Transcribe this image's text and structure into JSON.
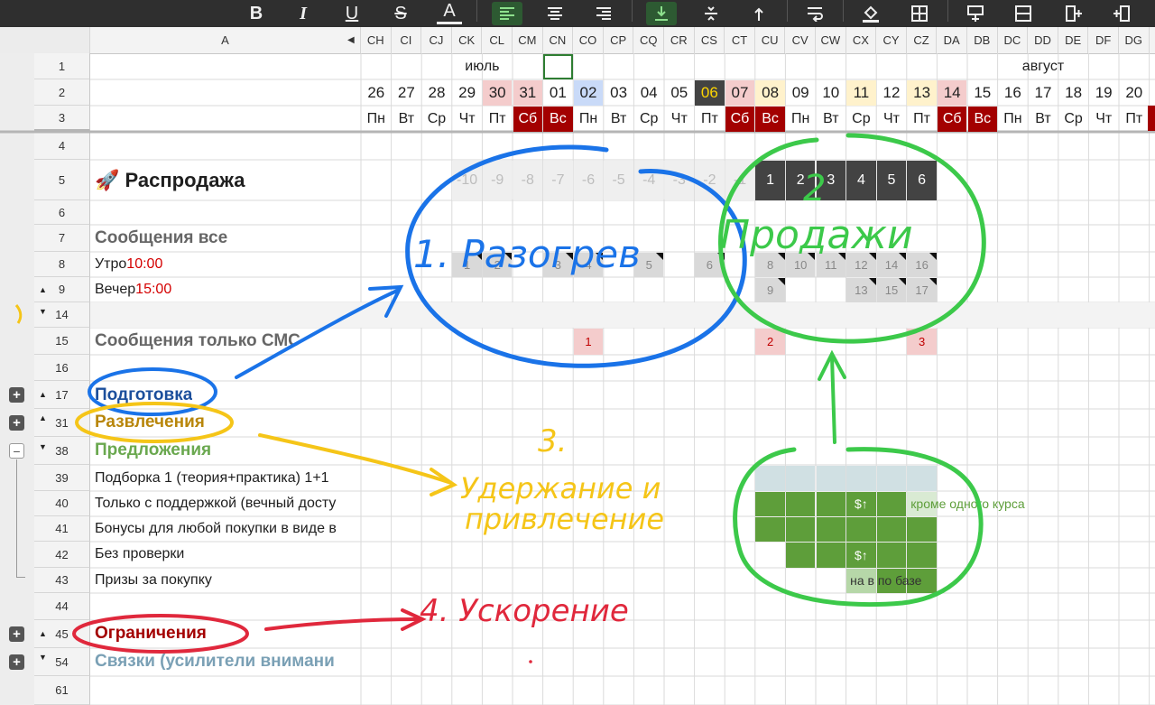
{
  "toolbar": {
    "buttons": [
      {
        "name": "bold-button",
        "glyph": "B"
      },
      {
        "name": "italic-button",
        "glyph": "I"
      },
      {
        "name": "underline-button",
        "glyph": "U"
      },
      {
        "name": "strikethrough-button",
        "glyph": "S"
      },
      {
        "name": "text-color-button",
        "glyph": "A"
      }
    ]
  },
  "columns": {
    "a": "A",
    "list": [
      "CH",
      "CI",
      "CJ",
      "CK",
      "CL",
      "CM",
      "CN",
      "CO",
      "CP",
      "CQ",
      "CR",
      "CS",
      "CT",
      "CU",
      "CV",
      "CW",
      "CX",
      "CY",
      "CZ",
      "DA",
      "DB",
      "DC",
      "DD",
      "DE",
      "DF",
      "DG"
    ]
  },
  "rows": {
    "numbers": [
      "1",
      "2",
      "3",
      "4",
      "5",
      "6",
      "7",
      "8",
      "9",
      "14",
      "15",
      "16",
      "17",
      "31",
      "38",
      "39",
      "40",
      "41",
      "42",
      "43",
      "44",
      "45",
      "54",
      "61"
    ]
  },
  "months": {
    "july": "июль",
    "august": "август"
  },
  "days": [
    "26",
    "27",
    "28",
    "29",
    "30",
    "31",
    "01",
    "02",
    "03",
    "04",
    "05",
    "06",
    "07",
    "08",
    "09",
    "10",
    "11",
    "12",
    "13",
    "14",
    "15",
    "16",
    "17",
    "18",
    "19",
    "20"
  ],
  "weekdays": [
    "Пн",
    "Вт",
    "Ср",
    "Чт",
    "Пт",
    "Сб",
    "Вс",
    "Пн",
    "Вт",
    "Ср",
    "Чт",
    "Пт",
    "Сб",
    "Вс",
    "Пн",
    "Вт",
    "Ср",
    "Чт",
    "Пт",
    "Сб",
    "Вс",
    "Пн",
    "Вт",
    "Ср",
    "Чт",
    "Пт"
  ],
  "sheet": {
    "title": "🚀 Распродажа",
    "messages_all": "Сообщения все",
    "morning_label": "Утро ",
    "morning_time": "10:00",
    "evening_label": "Вечер ",
    "evening_time": "15:00",
    "sms_only": "Сообщения только СМС",
    "preparation": "Подготовка",
    "entertainment": "Развлечения",
    "offers": "Предложения",
    "item39": "Подборка 1 (теория+практика) 1+1",
    "item40": "Только с поддержкой (вечный досту",
    "item41": "Бонусы для любой покупки в виде в",
    "item42": "Без проверки",
    "item43": "Призы за покупку",
    "limits": "Ограничения",
    "links": "Связки (усилители внимани"
  },
  "countdown": [
    "-10",
    "-9",
    "-8",
    "-7",
    "-6",
    "-5",
    "-4",
    "-3",
    "-2",
    "-1",
    "1",
    "2",
    "3",
    "4",
    "5",
    "6"
  ],
  "row8": [
    "1",
    "2",
    "3",
    "4",
    "5",
    "6",
    "8",
    "10",
    "11",
    "12",
    "14",
    "16"
  ],
  "row9": [
    "9",
    "13",
    "15",
    "17"
  ],
  "row15": [
    "1",
    "2",
    "3"
  ],
  "offers_cells": {
    "price_up": "$↑",
    "except_one": "кроме одного курса",
    "by_base": "на в по базе"
  },
  "annotations": {
    "a1": "1. Разогрев",
    "a2": "Продажи",
    "a2n": "2",
    "a3": "3.",
    "a3t1": "Удержание и",
    "a3t2": "привлечение",
    "a4": "4. Ускорение"
  },
  "colors": {
    "blue": "#1a73e8",
    "green": "#3cc94a",
    "yellow": "#f5c518",
    "red": "#e0283c",
    "header_red": "#a30000",
    "dark": "#434343",
    "offer_green": "#5e9e3a"
  }
}
